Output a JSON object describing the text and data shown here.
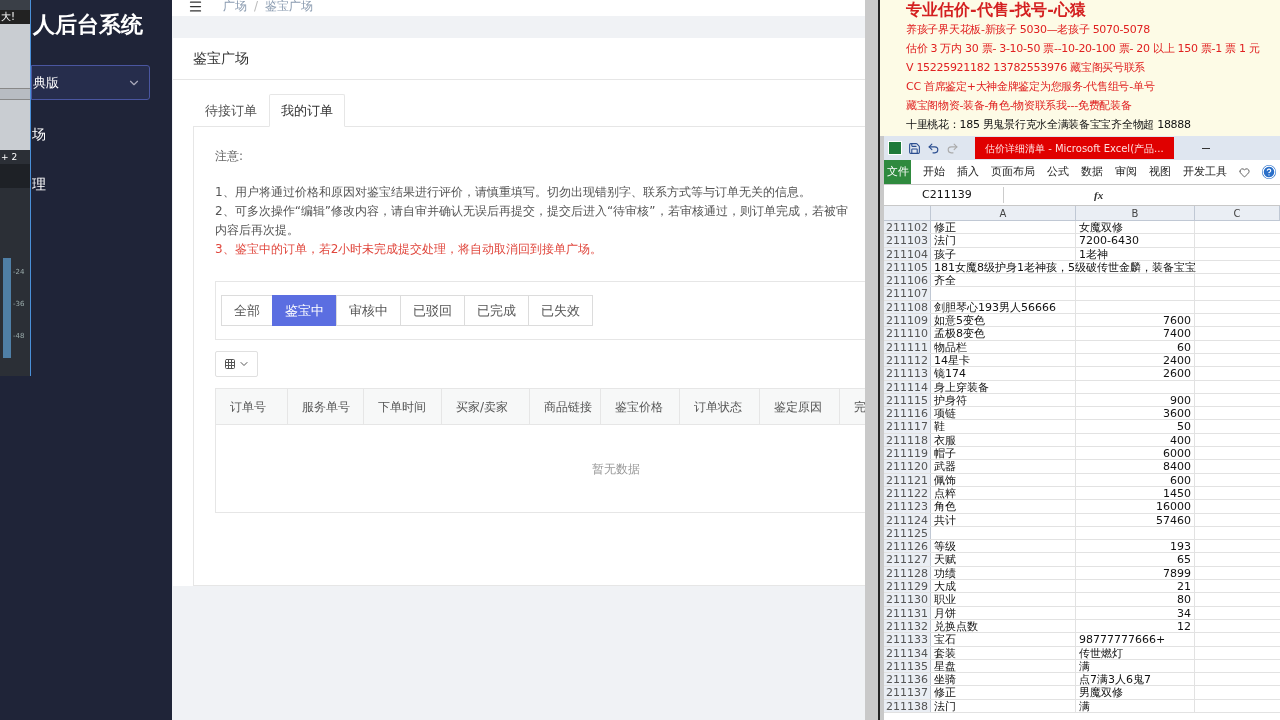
{
  "mixer": {
    "label": "大!",
    "channel": "+ 2",
    "scale": [
      "-24",
      "-36",
      "-48"
    ]
  },
  "sidebar": {
    "title": "人后台系统",
    "version_select": "典版",
    "items": [
      {
        "label": "场"
      },
      {
        "label": "理"
      }
    ]
  },
  "breadcrumb": {
    "items": [
      "广场",
      "鉴宝广场"
    ],
    "separator": "/"
  },
  "page": {
    "title": "鉴宝广场",
    "tabs": [
      {
        "label": "待接订单",
        "selected": false
      },
      {
        "label": "我的订单",
        "selected": true
      }
    ],
    "notice": {
      "heading": "注意:",
      "lines": [
        {
          "text": "1、用户将通过价格和原因对鉴宝结果进行评价，请慎重填写。切勿出现错别字、联系方式等与订单无关的信息。",
          "kind": "normal"
        },
        {
          "text": "2、可多次操作“编辑”修改内容，请自审并确认无误后再提交，提交后进入“待审核”，若审核通过，则订单完成，若被审",
          "kind": "normal"
        },
        {
          "text": "内容后再次提。",
          "kind": "normal"
        },
        {
          "text": "3、鉴宝中的订单，若2小时未完成提交处理，将自动取消回到接单广场。",
          "kind": "warning"
        }
      ]
    },
    "filters": [
      {
        "label": "全部",
        "selected": false
      },
      {
        "label": "鉴宝中",
        "selected": true
      },
      {
        "label": "审核中",
        "selected": false
      },
      {
        "label": "已驳回",
        "selected": false
      },
      {
        "label": "已完成",
        "selected": false
      },
      {
        "label": "已失效",
        "selected": false
      }
    ],
    "table": {
      "columns": [
        "订单号",
        "服务单号",
        "下单时间",
        "买家/卖家",
        "商品链接",
        "鉴宝价格",
        "订单状态",
        "鉴定原因",
        "完"
      ],
      "empty_text": "暂无数据"
    }
  },
  "document": {
    "lines": [
      {
        "text": "专业估价-代售-找号-心猿",
        "kind": "heading"
      },
      {
        "text": "养孩子界天花板-新孩子 5030—老孩子 5070-5078",
        "kind": "promo"
      },
      {
        "text": "估价 3 万内 30 票- 3-10-50 票--10-20-100 票- 20 以上 150 票-1 票 1 元",
        "kind": "promo"
      },
      {
        "text": "V 15225921182      13782553976    藏宝阁买号联系",
        "kind": "promo"
      },
      {
        "text": "CC 首席鉴定+大神金牌鉴定为您服务-代售组号-单号",
        "kind": "promo"
      },
      {
        "text": "藏宝阁物资-装备-角色-物资联系我---免费配装备",
        "kind": "promo"
      },
      {
        "text": "十里桃花：185 男鬼景行克水全满装备宝宝齐全物超 18888",
        "kind": "plain"
      }
    ]
  },
  "excel": {
    "title": "估价详细清单 - Microsoft Excel(产品...",
    "file_tab": "文件",
    "ribbon_tabs": [
      "开始",
      "插入",
      "页面布局",
      "公式",
      "数据",
      "审阅",
      "视图",
      "开发工具"
    ],
    "name_box": "C211139",
    "fx": "fx",
    "columns": [
      "A",
      "B",
      "C"
    ],
    "rows": [
      {
        "number": "211102",
        "a": "修正",
        "b": "女魔双修",
        "kind": "text"
      },
      {
        "number": "211103",
        "a": "法门",
        "b": "7200-6430",
        "kind": "text"
      },
      {
        "number": "211104",
        "a": "孩子",
        "b": "1老神",
        "kind": "text"
      },
      {
        "number": "211105",
        "a": "181女魔8级护身1老神孩，5级破传世金麟，装备宝宝",
        "kind": "text"
      },
      {
        "number": "211106",
        "a": "齐全",
        "kind": "text"
      },
      {
        "number": "211107",
        "kind": "text"
      },
      {
        "number": "211108",
        "a": "剑胆琴心193男人56666",
        "kind": "text"
      },
      {
        "number": "211109",
        "a": "如意5变色",
        "b": "7600",
        "kind": "number"
      },
      {
        "number": "211110",
        "a": "孟极8变色",
        "b": "7400",
        "kind": "number"
      },
      {
        "number": "211111",
        "a": "物品栏",
        "b": "60",
        "kind": "number"
      },
      {
        "number": "211112",
        "a": "14星卡",
        "b": "2400",
        "kind": "number"
      },
      {
        "number": "211113",
        "a": "镜174",
        "b": "2600",
        "kind": "number"
      },
      {
        "number": "211114",
        "a": "身上穿装备",
        "kind": "text"
      },
      {
        "number": "211115",
        "a": "护身符",
        "b": "900",
        "kind": "number"
      },
      {
        "number": "211116",
        "a": "项链",
        "b": "3600",
        "kind": "number"
      },
      {
        "number": "211117",
        "a": "鞋",
        "b": "50",
        "kind": "number"
      },
      {
        "number": "211118",
        "a": "衣服",
        "b": "400",
        "kind": "number"
      },
      {
        "number": "211119",
        "a": "帽子",
        "b": "6000",
        "kind": "number"
      },
      {
        "number": "211120",
        "a": "武器",
        "b": "8400",
        "kind": "number"
      },
      {
        "number": "211121",
        "a": "佩饰",
        "b": "600",
        "kind": "number"
      },
      {
        "number": "211122",
        "a": "点粹",
        "b": "1450",
        "kind": "number"
      },
      {
        "number": "211123",
        "a": "角色",
        "b": "16000",
        "kind": "number"
      },
      {
        "number": "211124",
        "a": "共计",
        "b": "57460",
        "kind": "number"
      },
      {
        "number": "211125",
        "kind": "text"
      },
      {
        "number": "211126",
        "a": "等级",
        "b": "193",
        "kind": "number"
      },
      {
        "number": "211127",
        "a": "天赋",
        "b": "65",
        "kind": "number"
      },
      {
        "number": "211128",
        "a": "功绩",
        "b": "7899",
        "kind": "number"
      },
      {
        "number": "211129",
        "a": "大成",
        "b": "21",
        "kind": "number"
      },
      {
        "number": "211130",
        "a": "职业",
        "b": "80",
        "kind": "number"
      },
      {
        "number": "211131",
        "a": "月饼",
        "b": "34",
        "kind": "number"
      },
      {
        "number": "211132",
        "a": "兑换点数",
        "b": "12",
        "kind": "number"
      },
      {
        "number": "211133",
        "a": "宝石",
        "b": "98777777666+",
        "kind": "text"
      },
      {
        "number": "211134",
        "a": "套装",
        "b": "传世燃灯",
        "kind": "text"
      },
      {
        "number": "211135",
        "a": "星盘",
        "b": "满",
        "kind": "text"
      },
      {
        "number": "211136",
        "a": "坐骑",
        "b": "点7满3人6鬼7",
        "kind": "text"
      },
      {
        "number": "211137",
        "a": "修正",
        "b": "男魔双修",
        "kind": "text"
      },
      {
        "number": "211138",
        "a": "法门",
        "b": "满",
        "kind": "text"
      }
    ]
  }
}
